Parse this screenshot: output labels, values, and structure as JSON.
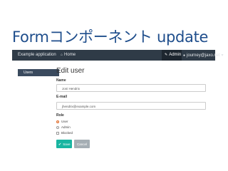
{
  "slide": {
    "title": "Formコンポーネント update"
  },
  "navbar": {
    "brand": "Example application",
    "home_label": "Home",
    "admin_label": "Admin",
    "user_label": "journey@jaxo.net",
    "user_caret": "▾",
    "bg_color": "#2f3b47"
  },
  "sidebar": {
    "items": [
      {
        "label": "Users"
      }
    ]
  },
  "main": {
    "title": "Edit user",
    "name": {
      "label": "Name",
      "value": "Joni Hendrix"
    },
    "email": {
      "label": "E-mail",
      "value": "jhendrix@example.com"
    },
    "role": {
      "label": "Role",
      "options": [
        {
          "label": "User",
          "selected": true
        },
        {
          "label": "Admin",
          "selected": false
        },
        {
          "label": "Blocked",
          "selected": false
        }
      ]
    },
    "save_label": "Save",
    "cancel_label": "Cancel"
  }
}
